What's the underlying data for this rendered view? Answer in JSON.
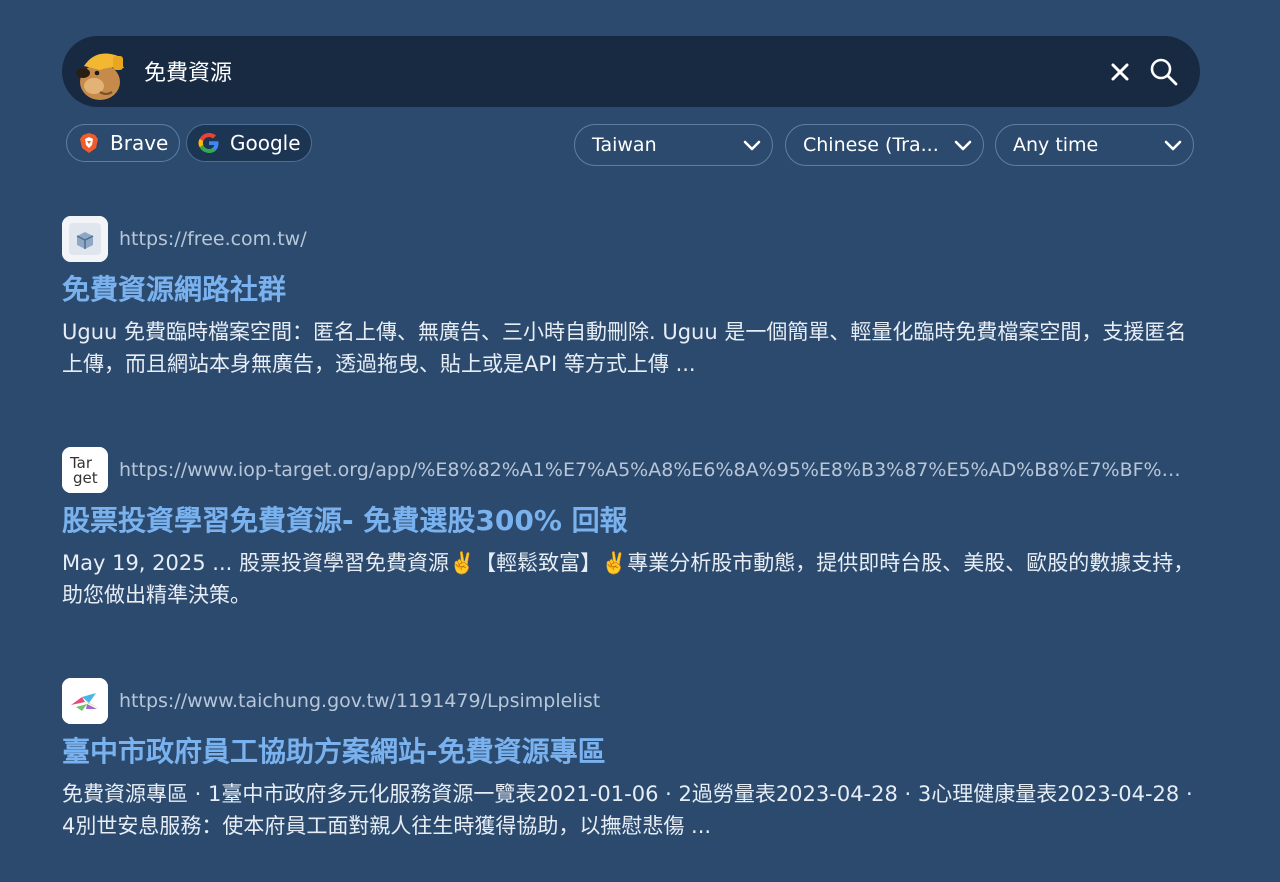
{
  "search": {
    "query": "免費資源",
    "placeholder": ""
  },
  "icons": {
    "logo": "mojeek-style-mole-logo",
    "clear": "close-icon",
    "search": "search-icon",
    "dropdown": "chevron-down-icon"
  },
  "engines": [
    {
      "label": "Brave",
      "icon": "brave-icon",
      "active": false
    },
    {
      "label": "Google",
      "icon": "google-icon",
      "active": true
    }
  ],
  "filters": {
    "region": "Taiwan",
    "language": "Chinese (Tra...",
    "time": "Any time"
  },
  "colors": {
    "background": "#2c4a6e",
    "search_bar": "#172a42",
    "title_link": "#79b2ee",
    "url_text": "#b7c6d8"
  },
  "results": [
    {
      "url": "https://free.com.tw/",
      "title": "免費資源網路社群",
      "snippet": "Uguu 免費臨時檔案空間：匿名上傳、無廣告、三小時自動刪除. Uguu 是一個簡單、輕量化臨時免費檔案空間，支援匿名上傳，而且網站本身無廣告，透過拖曳、貼上或是API 等方式上傳 ...",
      "favicon": "free-com-tw-favicon"
    },
    {
      "url": "https://www.iop-target.org/app/%E8%82%A1%E7%A5%A8%E6%8A%95%E8%B3%87%E5%AD%B8%E7%BF%92%E5...",
      "title": "股票投資學習免費資源- 免費選股300% 回報",
      "snippet": "May 19, 2025 ... 股票投資學習免費資源✌️【輕鬆致富】✌️專業分析股市動態，提供即時台股、美股、歐股的數據支持，助您做出精準決策。",
      "favicon_text_top": "Tar",
      "favicon_text_bottom": "get"
    },
    {
      "url": "https://www.taichung.gov.tw/1191479/Lpsimplelist",
      "title": "臺中市政府員工協助方案網站-免費資源專區",
      "snippet": "免費資源專區 · 1臺中市政府多元化服務資源一覽表2021-01-06 · 2過勞量表2023-04-28 · 3心理健康量表2023-04-28 · 4別世安息服務：使本府員工面對親人往生時獲得協助，以撫慰悲傷 ...",
      "favicon": "taichung-gov-favicon"
    }
  ]
}
